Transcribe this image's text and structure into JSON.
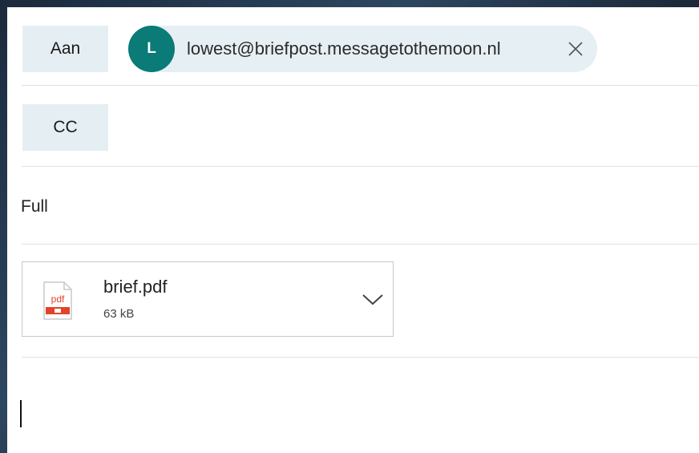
{
  "recipients": {
    "to_label": "Aan",
    "cc_label": "CC",
    "to_chip": {
      "initial": "L",
      "email": "lowest@briefpost.messagetothemoon.nl",
      "avatar_color": "#0a7b77",
      "remove_icon": "close-icon"
    }
  },
  "subject": {
    "value": "Full"
  },
  "attachment": {
    "name": "brief.pdf",
    "size": "63 kB",
    "icon": "pdf-file-icon",
    "icon_text": "pdf",
    "menu_icon": "chevron-down-icon"
  },
  "body": {
    "value": ""
  },
  "colors": {
    "accent": "#0a7b77",
    "button_bg": "#e5eef2",
    "pdf_red": "#e0442a"
  }
}
